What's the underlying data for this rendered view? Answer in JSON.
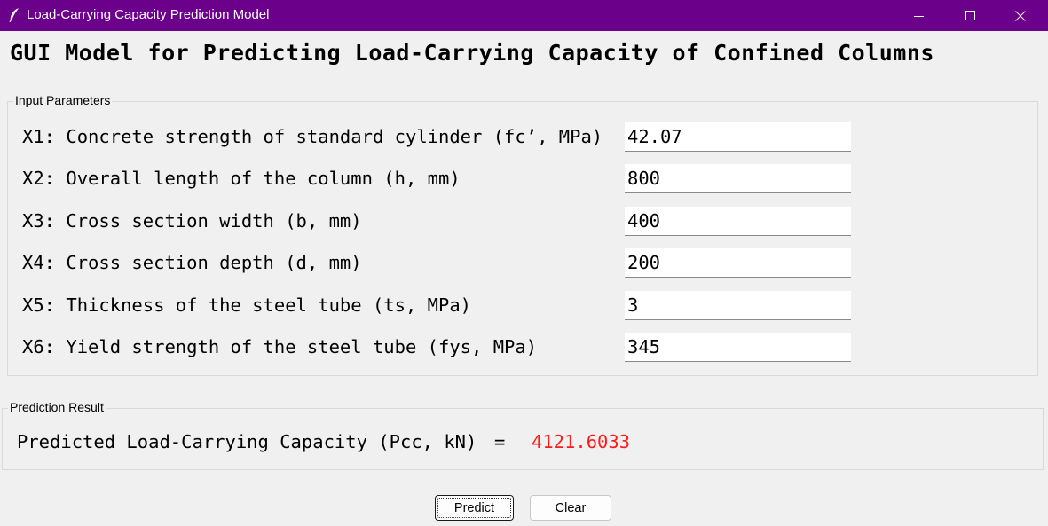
{
  "window": {
    "title": "Load-Carrying Capacity Prediction Model",
    "app_icon": "feather-icon",
    "titlebar_color": "#6b008b"
  },
  "heading": "GUI Model for Predicting Load-Carrying Capacity of Confined Columns",
  "input_group": {
    "label": "Input Parameters",
    "params": [
      {
        "label": "X1: Concrete strength of standard cylinder (fc’, MPa)",
        "value": "42.07"
      },
      {
        "label": "X2: Overall length of the column (h, mm)",
        "value": "800"
      },
      {
        "label": "X3: Cross section width (b, mm)",
        "value": "400"
      },
      {
        "label": "X4: Cross section depth (d, mm)",
        "value": "200"
      },
      {
        "label": "X5: Thickness of the steel tube (ts, MPa)",
        "value": "3"
      },
      {
        "label": "X6: Yield strength of the steel tube (fys, MPa)",
        "value": "345"
      }
    ]
  },
  "result_group": {
    "label": "Prediction Result",
    "result_label": "Predicted Load-Carrying Capacity (Pcc, kN)",
    "equals": "=",
    "result_value": "4121.6033",
    "result_color": "#ff1a1a"
  },
  "buttons": {
    "predict": "Predict",
    "clear": "Clear"
  }
}
